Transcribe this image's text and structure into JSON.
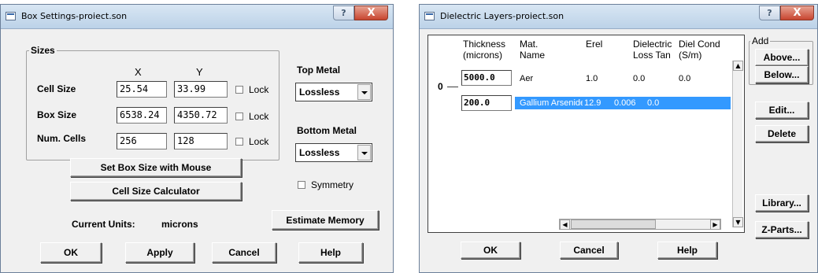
{
  "box_settings": {
    "title": "Box Settings-proiect.son",
    "help_btn": "?",
    "close_btn": "X",
    "sizes_group": "Sizes",
    "col_x": "X",
    "col_y": "Y",
    "rows": [
      {
        "label": "Cell Size",
        "x": "25.54",
        "y": "33.99",
        "lock": "Lock"
      },
      {
        "label": "Box Size",
        "x": "6538.24",
        "y": "4350.72",
        "lock": "Lock"
      },
      {
        "label": "Num. Cells",
        "x": "256",
        "y": "128",
        "lock": "Lock"
      }
    ],
    "set_box_size": "Set Box Size with Mouse",
    "cell_size_calc": "Cell Size Calculator",
    "current_units_label": "Current Units:",
    "current_units_value": "microns",
    "top_metal_label": "Top Metal",
    "top_metal_value": "Lossless",
    "bottom_metal_label": "Bottom Metal",
    "bottom_metal_value": "Lossless",
    "symmetry": "Symmetry",
    "estimate_memory": "Estimate Memory",
    "ok": "OK",
    "apply": "Apply",
    "cancel": "Cancel",
    "help": "Help"
  },
  "dielectric": {
    "title": "Dielectric Layers-proiect.son",
    "help_btn": "?",
    "close_btn": "X",
    "headers": {
      "thickness": "Thickness\n(microns)",
      "mat_name": "Mat.\nName",
      "erel": "Erel",
      "loss_tan": "Dielectric\nLoss Tan",
      "diel_cond": "Diel Cond\n(S/m)"
    },
    "layers": [
      {
        "thickness": "5000.0",
        "mat": "Aer",
        "erel": "1.0",
        "loss_tan": "0.0",
        "cond": "0.0"
      },
      {
        "thickness": "200.0",
        "mat": "Gallium Arsenide",
        "erel": "12.9",
        "loss_tan": "0.006",
        "cond": "0.0"
      }
    ],
    "level_marker": "0",
    "add_group": "Add",
    "above": "Above...",
    "below": "Below...",
    "edit": "Edit...",
    "delete": "Delete",
    "library": "Library...",
    "zparts": "Z-Parts...",
    "ok": "OK",
    "cancel": "Cancel",
    "help": "Help",
    "selected_color": "#3399ff"
  }
}
